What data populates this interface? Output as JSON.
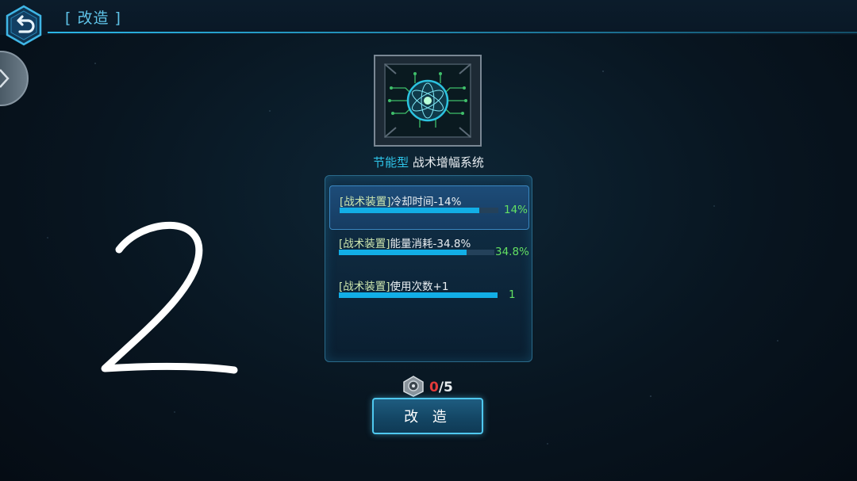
{
  "header": {
    "title": "[ 改造 ]"
  },
  "icons": {
    "back": "back-arrow-icon",
    "side": "chevron-left-icon",
    "item": "tactical-amplifier-core-icon",
    "cost": "part-material-icon"
  },
  "item": {
    "type": "节能型",
    "name": "战术增幅系统"
  },
  "stats": [
    {
      "tag": "[战术装置]",
      "text": "冷却时间-14%",
      "value": "14%",
      "fill": 0.88
    },
    {
      "tag": "[战术装置]",
      "text": "能量消耗-34.8%",
      "value": "34.8%",
      "fill": 0.82
    },
    {
      "tag": "[战术装置]",
      "text": "使用次数+1",
      "value": "1",
      "fill": 1.0
    }
  ],
  "cost": {
    "have": "0",
    "need": "/5"
  },
  "forge_button": {
    "label": "改 造"
  },
  "handwriting": "2",
  "colors": {
    "accent": "#2ec4e8",
    "bar": "#12aee6",
    "value": "#63e063",
    "warning": "#e23a3a"
  }
}
